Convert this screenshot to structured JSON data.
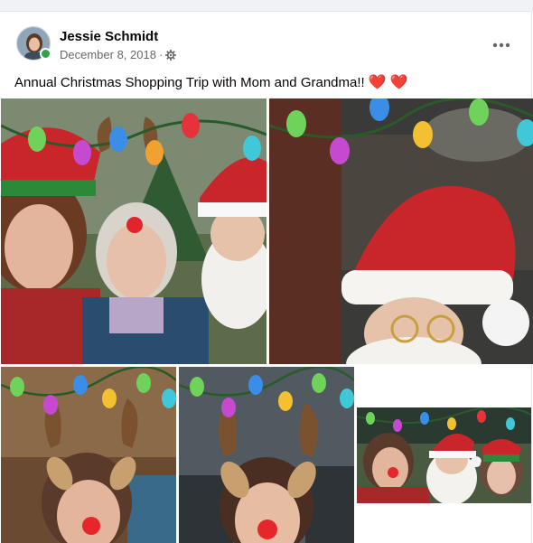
{
  "post": {
    "author_name": "Jessie Schmidt",
    "date": "December 8, 2018",
    "separator": "·",
    "privacy_icon": "gear-icon",
    "more_icon": "more-options-icon",
    "caption_text": "Annual Christmas Shopping Trip with Mom and Grandma!!",
    "caption_emoji": [
      "❤️",
      "❤️"
    ]
  },
  "photos": [
    {
      "name": "photo-1",
      "description_icon": "christmas-selfie-three-people"
    },
    {
      "name": "photo-2",
      "description_icon": "santa-filter-closeup"
    },
    {
      "name": "photo-3",
      "description_icon": "reindeer-filter-woman"
    },
    {
      "name": "photo-4",
      "description_icon": "reindeer-filter-young-woman"
    },
    {
      "name": "photo-5",
      "description_icon": "christmas-selfie-group-small"
    }
  ],
  "colors": {
    "text_primary": "#050505",
    "text_secondary": "#65676b",
    "online": "#31a24c",
    "heart": "#e41e3f"
  }
}
